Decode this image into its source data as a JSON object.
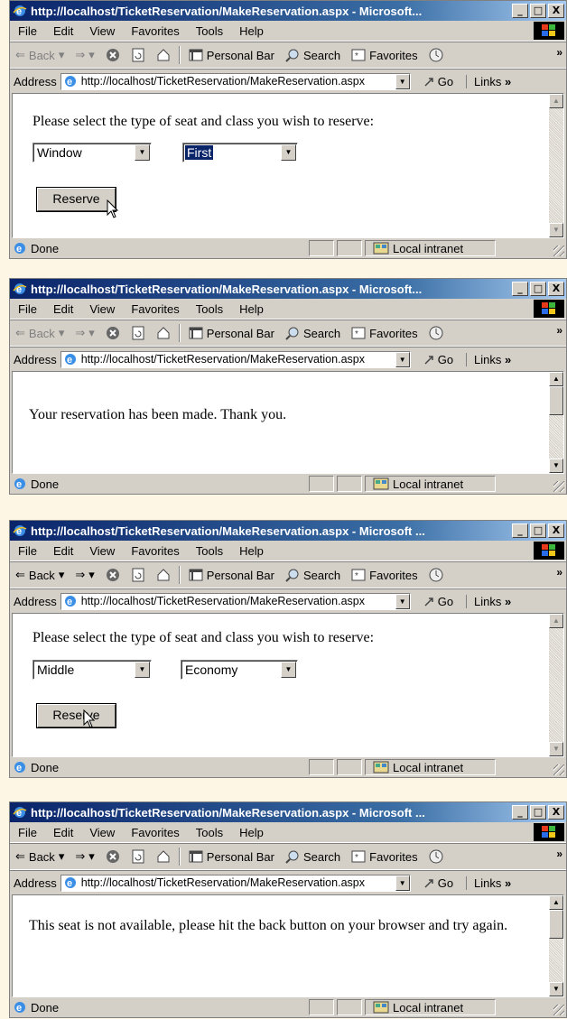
{
  "windows": [
    {
      "title": "http://localhost/TicketReservation/MakeReservation.aspx - Microsoft...",
      "url": "http://localhost/TicketReservation/MakeReservation.aspx",
      "prompt": "Please select the type of seat and class you wish to reserve:",
      "seat": "Window",
      "class": "First",
      "button": "Reserve"
    },
    {
      "title": "http://localhost/TicketReservation/MakeReservation.aspx - Microsoft...",
      "url": "http://localhost/TicketReservation/MakeReservation.aspx",
      "message": "Your reservation has been made. Thank you."
    },
    {
      "title": "http://localhost/TicketReservation/MakeReservation.aspx - Microsoft ...",
      "url": "http://localhost/TicketReservation/MakeReservation.aspx",
      "prompt": "Please select the type of seat and class you wish to reserve:",
      "seat": "Middle",
      "class": "Economy",
      "button": "Reserve"
    },
    {
      "title": "http://localhost/TicketReservation/MakeReservation.aspx - Microsoft ...",
      "url": "http://localhost/TicketReservation/MakeReservation.aspx",
      "message": "This seat is not available, please hit the back button on your browser and try again."
    }
  ],
  "menu": [
    "File",
    "Edit",
    "View",
    "Favorites",
    "Tools",
    "Help"
  ],
  "toolbar": {
    "back": "Back",
    "personal_bar": "Personal Bar",
    "search": "Search",
    "favorites": "Favorites"
  },
  "address": {
    "label": "Address",
    "go": "Go",
    "links": "Links"
  },
  "status": {
    "text": "Done",
    "zone": "Local intranet"
  },
  "window_buttons": {
    "minimize": "_",
    "maximize": "□",
    "close": "X"
  },
  "overflow": "»",
  "icons": [
    "ie-icon",
    "windows-logo-icon",
    "back-arrow-icon",
    "forward-arrow-icon",
    "stop-icon",
    "refresh-icon",
    "home-icon",
    "personal-bar-icon",
    "search-icon",
    "favorites-icon",
    "history-icon",
    "go-icon",
    "page-icon",
    "intranet-icon",
    "mouse-cursor-icon"
  ],
  "colors": {
    "titlebar": "#0a246a",
    "chrome": "#d4d0c8",
    "highlight": "#0a246a",
    "backdrop": "#fdf6e4"
  }
}
